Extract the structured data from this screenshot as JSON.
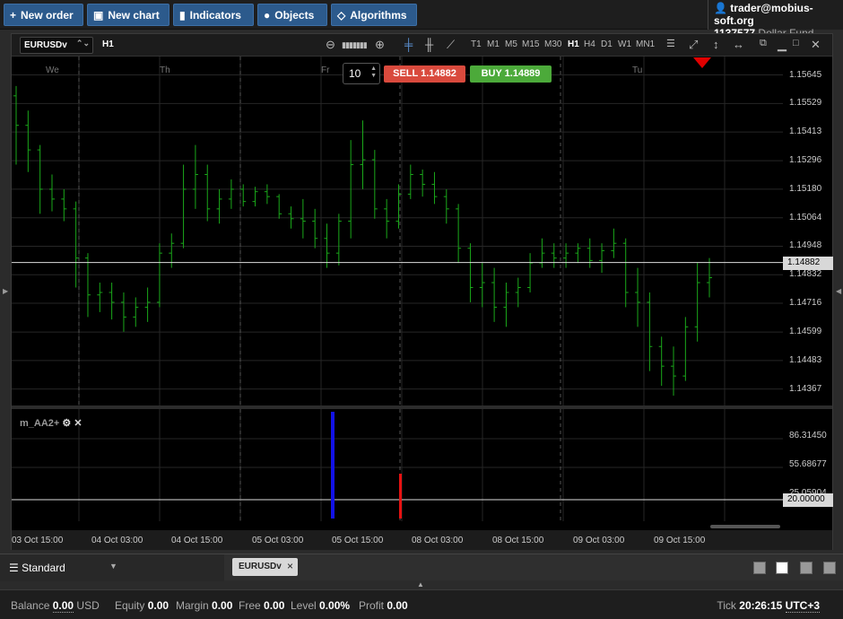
{
  "toolbar": {
    "new_order": "New order",
    "new_chart": "New chart",
    "indicators": "Indicators",
    "objects": "Objects",
    "algorithms": "Algorithms"
  },
  "account": {
    "user": "trader@mobius-soft.org",
    "number": "1137577",
    "fund": "Dollar Fund"
  },
  "chart": {
    "symbol": "EURUSDv",
    "timeframe_label": "H1",
    "timeframes": [
      "T1",
      "M1",
      "M5",
      "M15",
      "M30",
      "H1",
      "H4",
      "D1",
      "W1",
      "MN1"
    ],
    "active_timeframe": "H1",
    "days": [
      "We",
      "Th",
      "Fr",
      "Tu"
    ],
    "y_ticks": [
      "1.15645",
      "1.15529",
      "1.15413",
      "1.15296",
      "1.15180",
      "1.15064",
      "1.14948",
      "1.14832",
      "1.14716",
      "1.14599",
      "1.14483",
      "1.14367"
    ],
    "current_price": "1.14882",
    "x_ticks": [
      "03 Oct 15:00",
      "04 Oct 03:00",
      "04 Oct 15:00",
      "05 Oct 03:00",
      "05 Oct 15:00",
      "08 Oct 03:00",
      "08 Oct 15:00",
      "09 Oct 03:00",
      "09 Oct 15:00"
    ]
  },
  "order": {
    "volume": "10",
    "sell_label": "SELL",
    "sell_price": "1.14882",
    "buy_label": "BUY",
    "buy_price": "1.14889"
  },
  "indicator": {
    "name": "m_AA2+",
    "y_ticks": [
      "86.31450",
      "55.68677",
      "25.05904"
    ],
    "level": "20.00000"
  },
  "bottom": {
    "layout": "Standard",
    "symbol_tab": "EURUSDv"
  },
  "status": {
    "balance_label": "Balance",
    "balance": "0.00",
    "currency": "USD",
    "equity_label": "Equity",
    "equity": "0.00",
    "margin_label": "Margin",
    "margin": "0.00",
    "free_label": "Free",
    "free": "0.00",
    "level_label": "Level",
    "level": "0.00%",
    "profit_label": "Profit",
    "profit": "0.00",
    "tick_label": "Tick",
    "tick_time": "20:26:15",
    "timezone": "UTC+3"
  },
  "colors": {
    "bar": "#1aa81a",
    "accent": "#2c5a8c",
    "sell": "#d94a3d",
    "buy": "#4caa3a",
    "ind_blue": "#1212e6",
    "ind_red": "#e61212"
  },
  "chart_data": {
    "type": "ohlc",
    "series": [
      {
        "name": "EURUSDv",
        "values": [
          [
            1.1556,
            1.156,
            1.1528,
            1.1544
          ],
          [
            1.1544,
            1.155,
            1.1525,
            1.1534
          ],
          [
            1.1534,
            1.1536,
            1.1508,
            1.1518
          ],
          [
            1.1518,
            1.1524,
            1.1509,
            1.1514
          ],
          [
            1.1514,
            1.1518,
            1.1505,
            1.151
          ],
          [
            1.151,
            1.1513,
            1.1478,
            1.149
          ],
          [
            1.149,
            1.1492,
            1.1466,
            1.1475
          ],
          [
            1.1475,
            1.148,
            1.1468,
            1.1476
          ],
          [
            1.1476,
            1.148,
            1.1465,
            1.1472
          ],
          [
            1.1472,
            1.1476,
            1.146,
            1.1466
          ],
          [
            1.1466,
            1.1474,
            1.1462,
            1.147
          ],
          [
            1.147,
            1.1478,
            1.1464,
            1.1472
          ],
          [
            1.1472,
            1.1496,
            1.147,
            1.1492
          ],
          [
            1.1492,
            1.15,
            1.1486,
            1.1496
          ],
          [
            1.1496,
            1.1528,
            1.1494,
            1.1518
          ],
          [
            1.1518,
            1.1536,
            1.151,
            1.1524
          ],
          [
            1.1524,
            1.1528,
            1.1505,
            1.151
          ],
          [
            1.151,
            1.1518,
            1.1504,
            1.1514
          ],
          [
            1.1514,
            1.1522,
            1.151,
            1.1518
          ],
          [
            1.1518,
            1.152,
            1.1511,
            1.1513
          ],
          [
            1.1513,
            1.1519,
            1.1511,
            1.1517
          ],
          [
            1.1517,
            1.152,
            1.1512,
            1.1515
          ],
          [
            1.1515,
            1.1516,
            1.1506,
            1.1508
          ],
          [
            1.1508,
            1.1511,
            1.1502,
            1.1506
          ],
          [
            1.1506,
            1.1514,
            1.1498,
            1.1505
          ],
          [
            1.1505,
            1.151,
            1.1494,
            1.1498
          ],
          [
            1.1498,
            1.1504,
            1.1486,
            1.1492
          ],
          [
            1.1492,
            1.1508,
            1.1487,
            1.1505
          ],
          [
            1.1505,
            1.1538,
            1.1498,
            1.1528
          ],
          [
            1.1528,
            1.1546,
            1.1518,
            1.153
          ],
          [
            1.153,
            1.1534,
            1.1506,
            1.151
          ],
          [
            1.151,
            1.1514,
            1.1498,
            1.1505
          ],
          [
            1.1505,
            1.152,
            1.1502,
            1.1516
          ],
          [
            1.1516,
            1.1528,
            1.1514,
            1.1524
          ],
          [
            1.1524,
            1.1526,
            1.1515,
            1.152
          ],
          [
            1.152,
            1.1525,
            1.1512,
            1.1515
          ],
          [
            1.1515,
            1.1518,
            1.1504,
            1.151
          ],
          [
            1.151,
            1.1512,
            1.1488,
            1.1494
          ],
          [
            1.1494,
            1.1496,
            1.1472,
            1.1478
          ],
          [
            1.1478,
            1.1488,
            1.147,
            1.148
          ],
          [
            1.148,
            1.1486,
            1.1464,
            1.147
          ],
          [
            1.147,
            1.148,
            1.1462,
            1.1476
          ],
          [
            1.1476,
            1.1482,
            1.147,
            1.1478
          ],
          [
            1.1478,
            1.1492,
            1.1476,
            1.1488
          ],
          [
            1.1488,
            1.1498,
            1.1486,
            1.1492
          ],
          [
            1.1492,
            1.1496,
            1.1486,
            1.149
          ],
          [
            1.149,
            1.1496,
            1.1486,
            1.1492
          ],
          [
            1.1492,
            1.1496,
            1.1488,
            1.1494
          ],
          [
            1.1494,
            1.1498,
            1.1486,
            1.1489
          ],
          [
            1.1489,
            1.1496,
            1.1484,
            1.1493
          ],
          [
            1.1493,
            1.1502,
            1.149,
            1.1496
          ],
          [
            1.1496,
            1.1498,
            1.147,
            1.1476
          ],
          [
            1.1476,
            1.1486,
            1.1462,
            1.1472
          ],
          [
            1.1472,
            1.1476,
            1.1444,
            1.1454
          ],
          [
            1.1454,
            1.1458,
            1.1438,
            1.1446
          ],
          [
            1.1446,
            1.1454,
            1.1434,
            1.1442
          ],
          [
            1.1442,
            1.1466,
            1.144,
            1.1462
          ],
          [
            1.1462,
            1.1488,
            1.1456,
            1.148
          ],
          [
            1.148,
            1.149,
            1.1474,
            1.1482
          ]
        ]
      }
    ],
    "y_range": [
      1.143,
      1.1572
    ]
  }
}
